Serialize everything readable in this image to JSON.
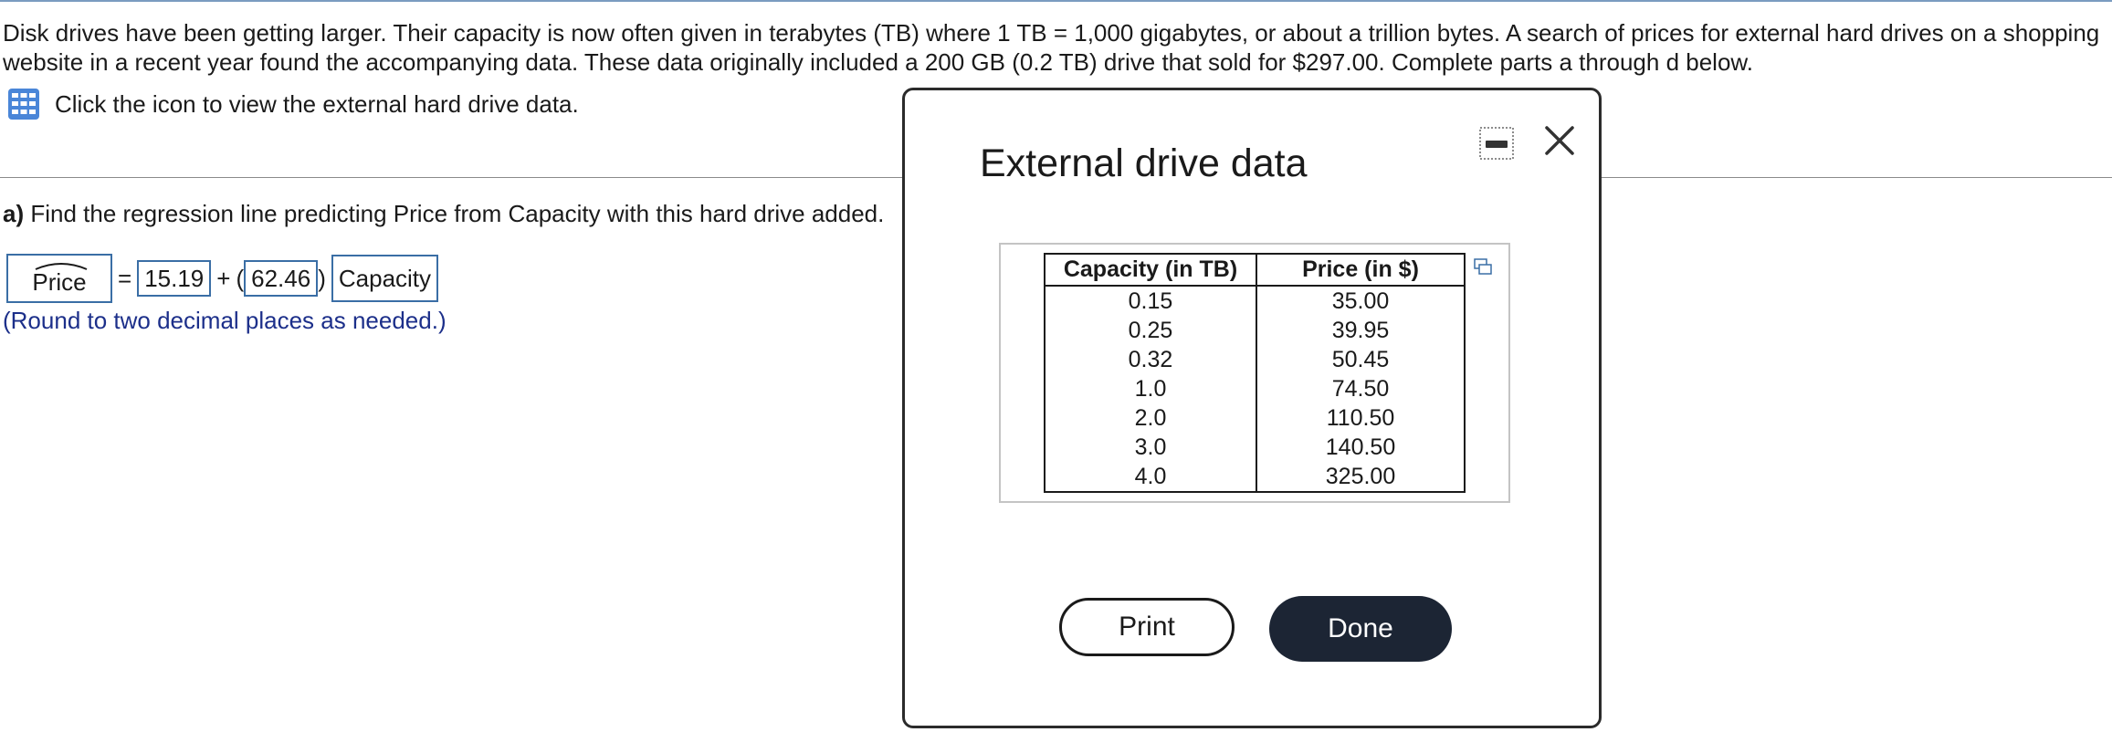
{
  "intro": {
    "text": "Disk drives have been getting larger. Their capacity is now often given in terabytes (TB) where 1 TB = 1,000 gigabytes, or about a trillion bytes. A search of prices for external hard drives on a shopping website in a recent year found the accompanying data. These data originally included a 200 GB (0.2 TB) drive that sold for $297.00. Complete parts a through d below."
  },
  "data_link": {
    "label": "Click the icon to view the external hard drive data.",
    "icon": "table-grid-icon"
  },
  "part_a": {
    "prefix": "a)",
    "question": "Find the regression line predicting Price from Capacity with this hard drive added.",
    "response_var": "Price",
    "equals": "=",
    "intercept": "15.19",
    "plus": "+",
    "open_paren": "(",
    "slope": "62.46",
    "close_paren": ")",
    "predictor": "Capacity",
    "hint": "(Round to two decimal places as needed.)"
  },
  "modal": {
    "title": "External drive data",
    "table": {
      "headers": [
        "Capacity (in TB)",
        "Price (in $)"
      ],
      "rows": [
        [
          "0.15",
          "35.00"
        ],
        [
          "0.25",
          "39.95"
        ],
        [
          "0.32",
          "50.45"
        ],
        [
          "1.0",
          "74.50"
        ],
        [
          "2.0",
          "110.50"
        ],
        [
          "3.0",
          "140.50"
        ],
        [
          "4.0",
          "325.00"
        ]
      ]
    },
    "print_label": "Print",
    "done_label": "Done"
  },
  "colors": {
    "accent": "#3a6ea5",
    "hint": "#1c2f8a",
    "done_bg": "#1c2534",
    "icon_blue": "#4a86d8"
  }
}
